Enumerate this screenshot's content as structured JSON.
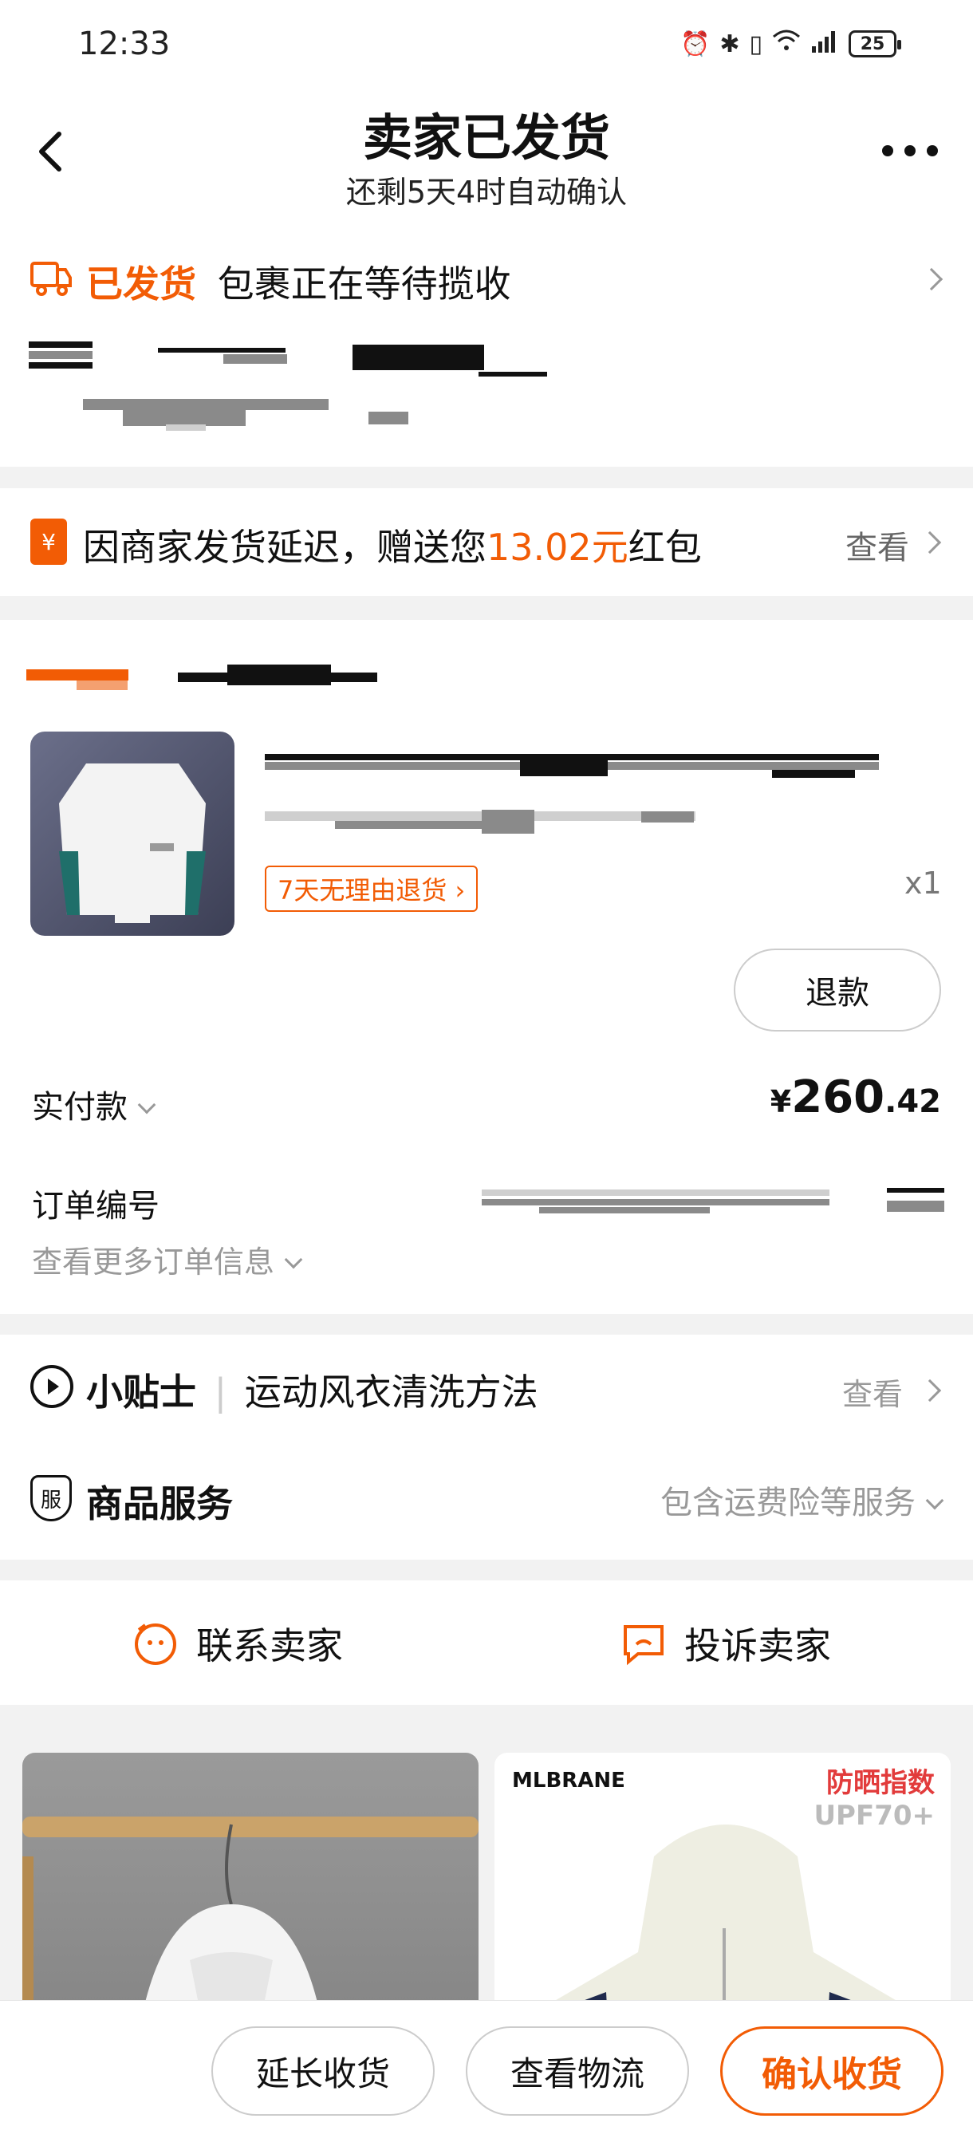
{
  "status_bar": {
    "time": "12:33",
    "battery": "25"
  },
  "header": {
    "title": "卖家已发货",
    "subtitle": "还剩5天4时自动确认"
  },
  "shipping": {
    "status": "已发货",
    "message": "包裹正在等待揽收"
  },
  "coupon": {
    "icon_text": "¥",
    "prefix": "因商家发货延迟，赠送您",
    "amount": "13.02元",
    "suffix": "红包",
    "action": "查看"
  },
  "product": {
    "return_badge": "7天无理由退货",
    "quantity": "x1",
    "refund_label": "退款"
  },
  "payment": {
    "label": "实付款",
    "currency": "¥",
    "int": "260",
    "dec": ".42"
  },
  "order": {
    "number_label": "订单编号",
    "more_info": "查看更多订单信息"
  },
  "tips": {
    "title": "小贴士",
    "text": "运动风衣清洗方法",
    "action": "查看"
  },
  "service": {
    "icon_text": "服",
    "title": "商品服务",
    "detail": "包含运费险等服务"
  },
  "contact": {
    "contact_seller": "联系卖家",
    "complain_seller": "投诉卖家"
  },
  "recommend": {
    "brand": "MLBRANE",
    "badge_line1": "防晒指数",
    "badge_line2": "UPF70+"
  },
  "bottom_bar": {
    "extend": "延长收货",
    "logistics": "查看物流",
    "confirm": "确认收货"
  },
  "colors": {
    "accent": "#f25c05",
    "background": "#f2f2f2"
  }
}
